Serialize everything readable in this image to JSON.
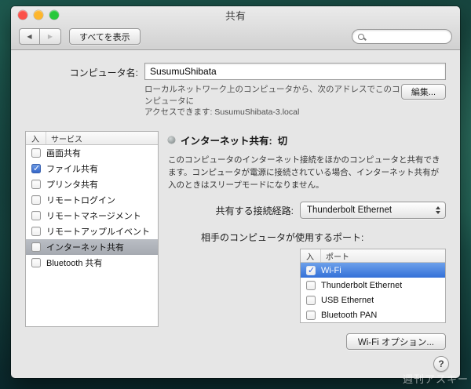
{
  "window": {
    "title": "共有",
    "toolbar": {
      "show_all": "すべてを表示"
    },
    "computer_name": {
      "label": "コンピュータ名:",
      "value": "SusumuShibata",
      "help_line1": "ローカルネットワーク上のコンピュータから、次のアドレスでこのコンピュータに",
      "help_line2": "アクセスできます: SusumuShibata-3.local",
      "edit_button": "編集..."
    },
    "services": {
      "columns": {
        "on": "入",
        "service": "サービス"
      },
      "items": [
        {
          "label": "画面共有",
          "checked": false,
          "selected": false
        },
        {
          "label": "ファイル共有",
          "checked": true,
          "selected": false
        },
        {
          "label": "プリンタ共有",
          "checked": false,
          "selected": false
        },
        {
          "label": "リモートログイン",
          "checked": false,
          "selected": false
        },
        {
          "label": "リモートマネージメント",
          "checked": false,
          "selected": false
        },
        {
          "label": "リモートアップルイベント",
          "checked": false,
          "selected": false
        },
        {
          "label": "インターネット共有",
          "checked": false,
          "selected": true
        },
        {
          "label": "Bluetooth 共有",
          "checked": false,
          "selected": false
        }
      ]
    },
    "detail": {
      "status_title": "インターネット共有:",
      "status_value": "切",
      "description": "このコンピュータのインターネット接続をほかのコンピュータと共有できます。コンピュータが電源に接続されている場合、インターネット共有が入のときはスリープモードになりません。",
      "share_from_label": "共有する接続経路:",
      "share_from_value": "Thunderbolt Ethernet",
      "ports_label": "相手のコンピュータが使用するポート:",
      "ports_columns": {
        "on": "入",
        "port": "ポート"
      },
      "ports": [
        {
          "label": "Wi-Fi",
          "checked": true,
          "selected": true
        },
        {
          "label": "Thunderbolt Ethernet",
          "checked": false,
          "selected": false
        },
        {
          "label": "USB Ethernet",
          "checked": false,
          "selected": false
        },
        {
          "label": "Bluetooth PAN",
          "checked": false,
          "selected": false
        }
      ],
      "wifi_options_button": "Wi-Fi オプション..."
    },
    "help_button": "?"
  },
  "colors": {
    "accent": "#3370d8",
    "inactive_selection": "#aeb2b9",
    "status_off_dot": "#8f9797"
  },
  "watermark": "週刊アスキー"
}
